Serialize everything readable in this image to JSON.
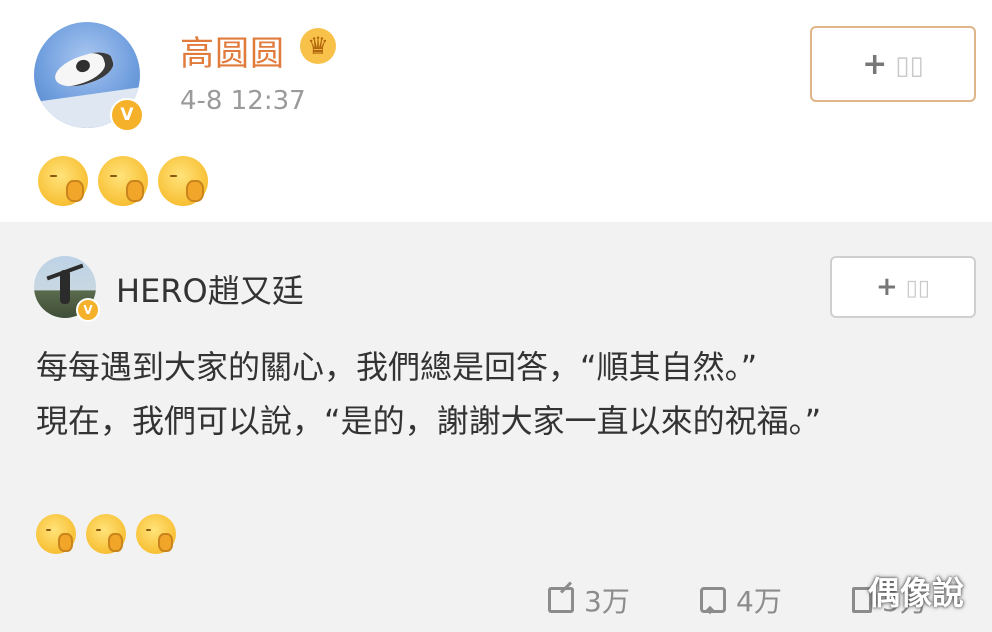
{
  "top_post": {
    "user_name": "高圆圆",
    "time": "4-8 12:37",
    "follow_label": "+ ▯▯",
    "verified_badge": "V",
    "emoji_icons": [
      "pray-emoji-icon",
      "pray-emoji-icon",
      "pray-emoji-icon"
    ]
  },
  "repost": {
    "user_name": "HERO趙又廷",
    "follow_label": "+ ▯▯",
    "verified_badge": "V",
    "text": "每每遇到大家的關心，我們總是回答，“順其自然。”\n現在，我們可以說，“是的，謝謝大家一直以來的祝福。”",
    "emoji_icons": [
      "pray-emoji-icon",
      "pray-emoji-icon",
      "pray-emoji-icon"
    ]
  },
  "actions": {
    "repost_count": "3万",
    "comment_count": "4万",
    "like_count": "5万"
  },
  "watermark": "偶像說",
  "colors": {
    "name_orange": "#e07b3c",
    "verified": "#f6b12b",
    "background_gray": "#f2f2f2"
  }
}
